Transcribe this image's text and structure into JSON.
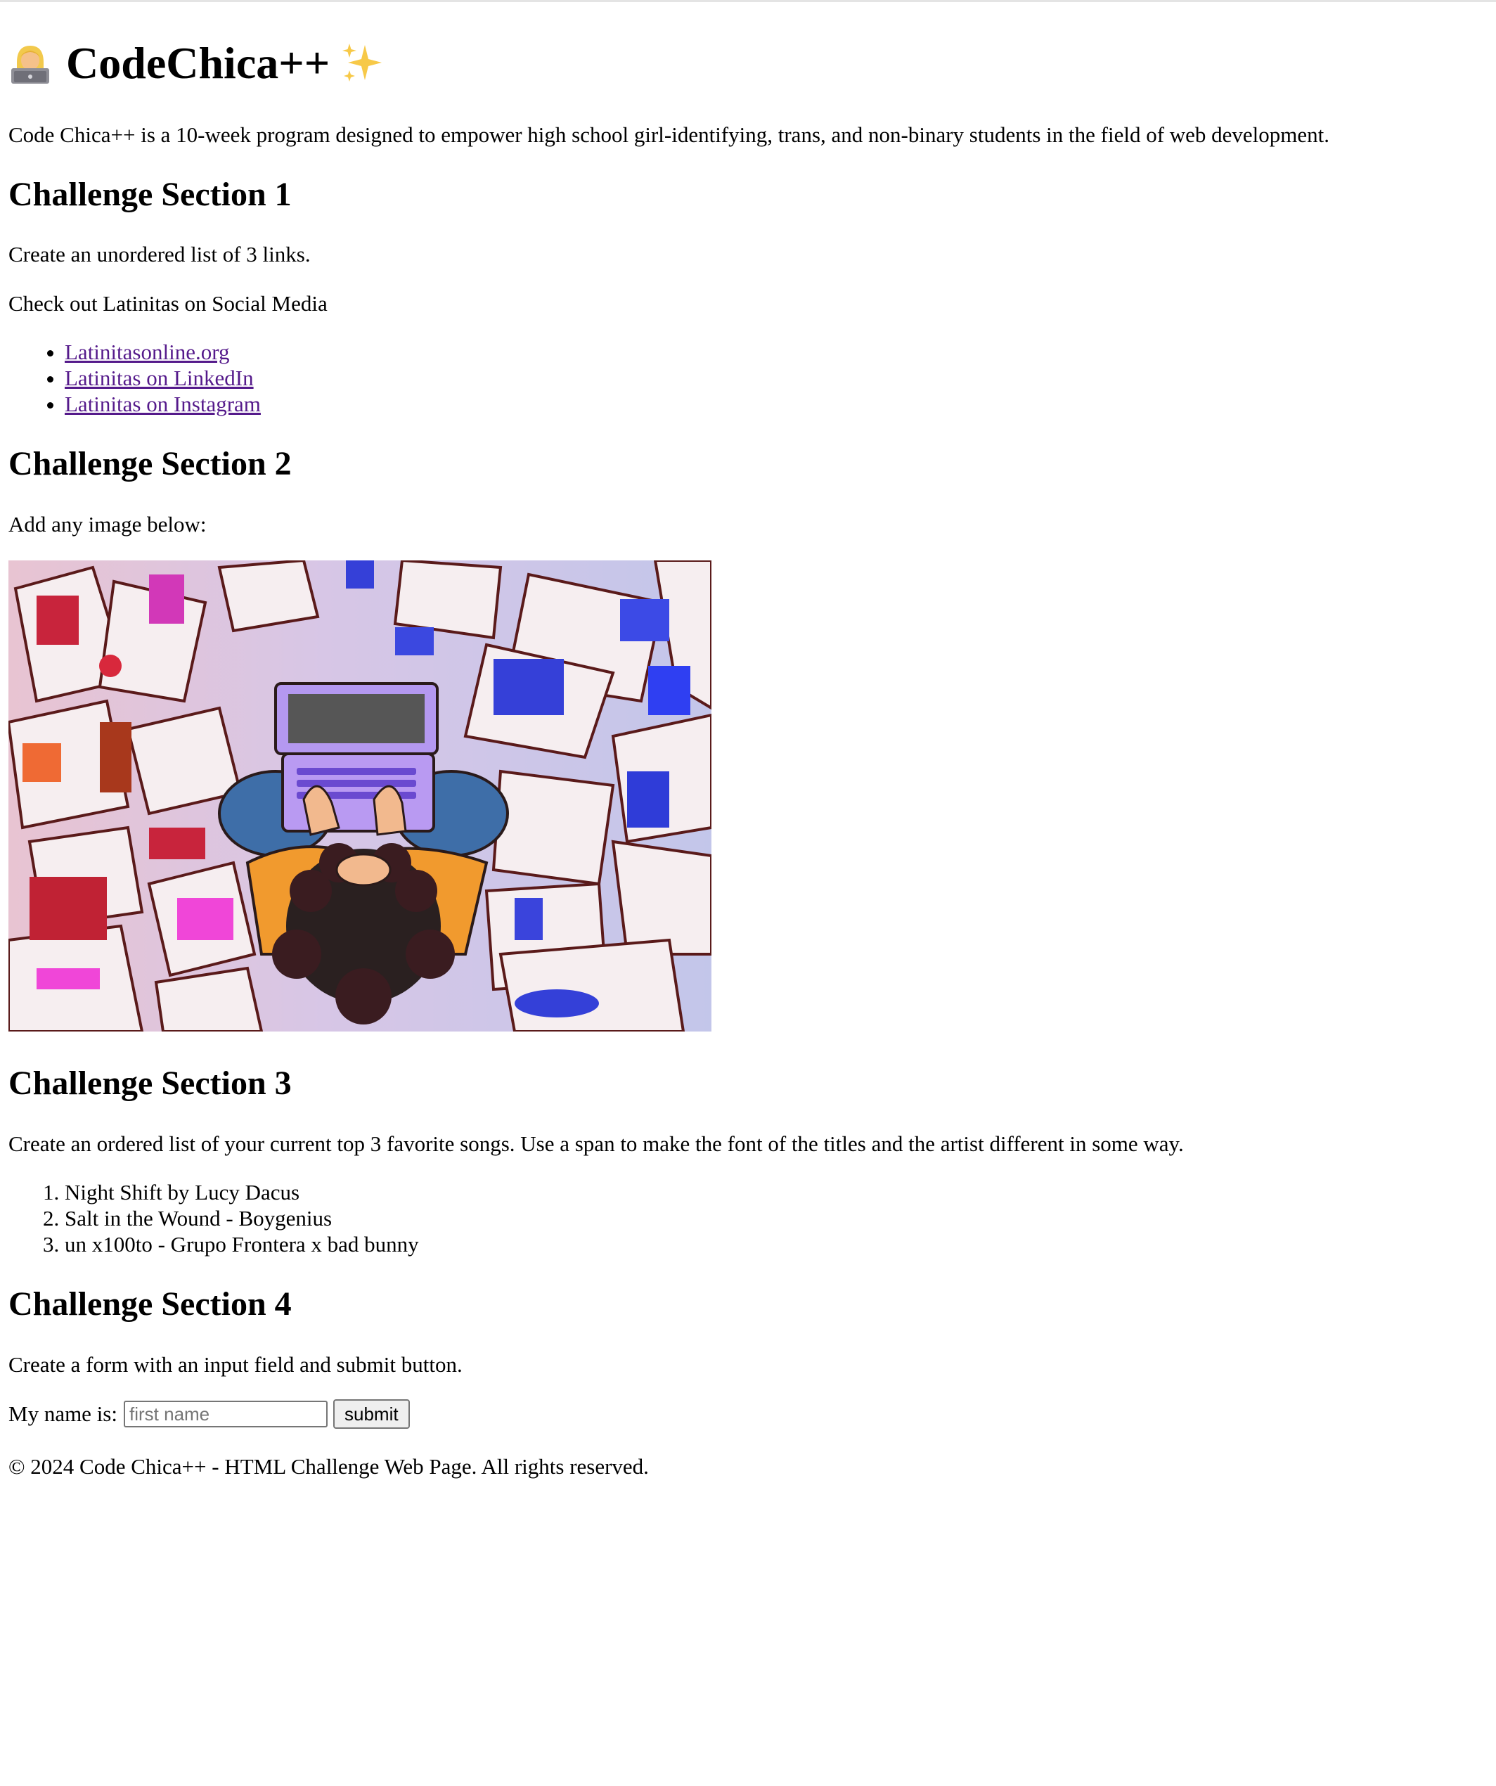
{
  "header": {
    "title": "CodeChica++",
    "title_emoji": "woman-technologist-icon",
    "title_suffix_emoji": "sparkles-icon"
  },
  "intro": "Code Chica++ is a 10-week program designed to empower high school girl-identifying, trans, and non-binary students in the field of web development.",
  "section1": {
    "heading": "Challenge Section 1",
    "instruction": "Create an unordered list of 3 links.",
    "subtitle": "Check out Latinitas on Social Media",
    "links": [
      "Latinitasonline.org",
      "Latinitas on LinkedIn",
      "Latinitas on Instagram"
    ],
    "link_color": "#551a8b"
  },
  "section2": {
    "heading": "Challenge Section 2",
    "instruction": "Add any image below:",
    "image_description": "illustration-girl-with-laptop-icon"
  },
  "section3": {
    "heading": "Challenge Section 3",
    "instruction": "Create an ordered list of your current top 3 favorite songs. Use a span to make the font of the titles and the artist different in some way.",
    "songs": [
      "Night Shift by Lucy Dacus",
      "Salt in the Wound - Boygenius",
      "un x100to - Grupo Frontera x bad bunny"
    ]
  },
  "section4": {
    "heading": "Challenge Section 4",
    "instruction": "Create a form with an input field and submit button.",
    "form": {
      "label": "My name is:",
      "placeholder": "first name",
      "value": "",
      "submit_label": "submit"
    }
  },
  "footer": "© 2024 Code Chica++ - HTML Challenge Web Page. All rights reserved."
}
